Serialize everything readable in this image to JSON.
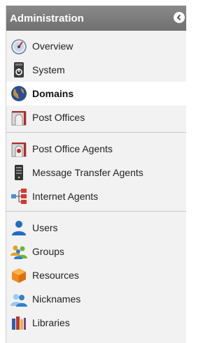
{
  "header": {
    "title": "Administration"
  },
  "groups": [
    {
      "items": [
        {
          "label": "Overview",
          "icon": "dashboard-gauge-icon",
          "selected": false
        },
        {
          "label": "System",
          "icon": "server-power-icon",
          "selected": false
        },
        {
          "label": "Domains",
          "icon": "globe-icon",
          "selected": true
        },
        {
          "label": "Post Offices",
          "icon": "post-office-icon",
          "selected": false
        }
      ]
    },
    {
      "items": [
        {
          "label": "Post Office Agents",
          "icon": "post-office-agent-icon",
          "selected": false
        },
        {
          "label": "Message Transfer Agents",
          "icon": "server-tower-icon",
          "selected": false
        },
        {
          "label": "Internet Agents",
          "icon": "network-hierarchy-icon",
          "selected": false
        }
      ]
    },
    {
      "items": [
        {
          "label": "Users",
          "icon": "user-icon",
          "selected": false
        },
        {
          "label": "Groups",
          "icon": "group-icon",
          "selected": false
        },
        {
          "label": "Resources",
          "icon": "resource-box-icon",
          "selected": false
        },
        {
          "label": "Nicknames",
          "icon": "nickname-users-icon",
          "selected": false
        },
        {
          "label": "Libraries",
          "icon": "books-icon",
          "selected": false
        }
      ]
    }
  ],
  "colors": {
    "header_bg": "#7d7d7d",
    "selected_bg": "#ffffff",
    "panel_bg": "#f2f2f2"
  }
}
